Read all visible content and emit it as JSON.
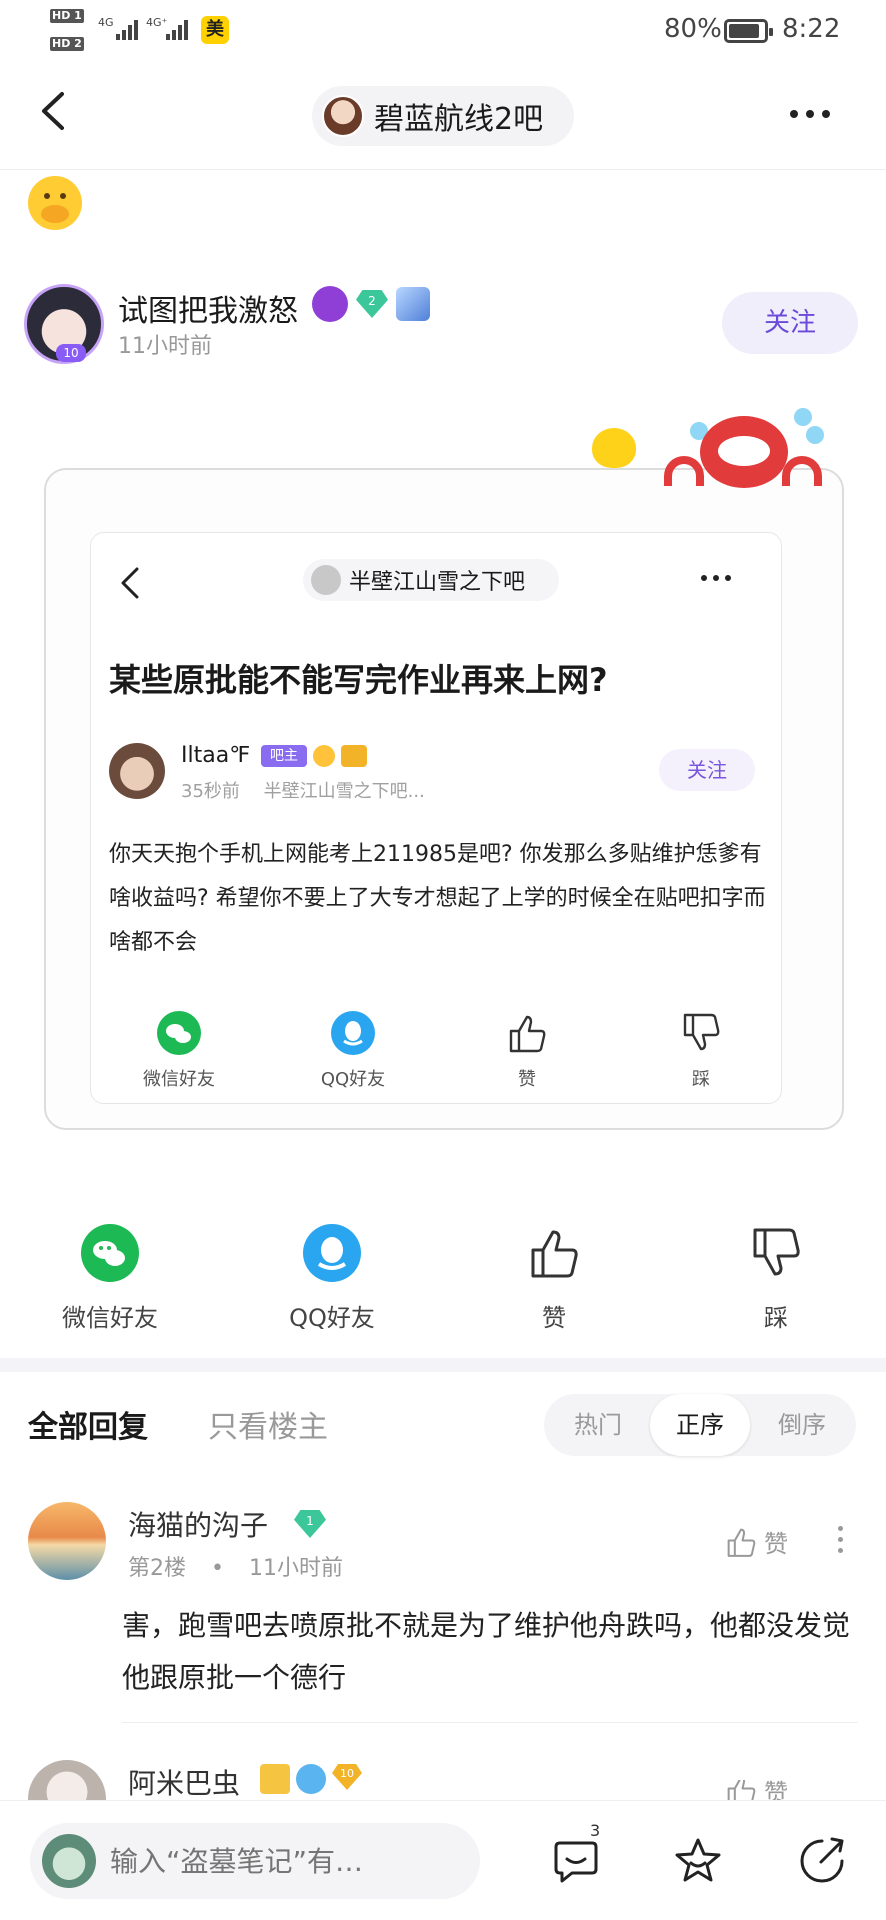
{
  "status_bar": {
    "hd1": "HD 1",
    "hd2": "HD 2",
    "sig1": "4G",
    "sig2": "4G⁺",
    "mei": "美",
    "battery": "80%",
    "time": "8:22"
  },
  "header": {
    "forum_name": "碧蓝航线2吧"
  },
  "author": {
    "name": "试图把我激怒",
    "level": "2",
    "time": "11小时前",
    "follow_label": "关注",
    "avatar_badge": "10"
  },
  "screenshot": {
    "forum_name": "半壁江山雪之下吧",
    "title": "某些原批能不能写完作业再来上网?",
    "user_name": "Iltaa℉",
    "owner_badge": "吧主",
    "meta_time": "35秒前",
    "meta_forum": "半壁江山雪之下吧...",
    "follow_label": "关注",
    "body": "你天天抱个手机上网能考上211985是吧? 你发那么多贴维护恁爹有啥收益吗? 希望你不要上了大专才想起了上学的时候全在贴吧扣字而啥都不会",
    "actions": [
      "微信好友",
      "QQ好友",
      "赞",
      "踩"
    ]
  },
  "share": {
    "wechat": "微信好友",
    "qq": "QQ好友",
    "like": "赞",
    "dislike": "踩"
  },
  "replies": {
    "tab_all": "全部回复",
    "tab_owner": "只看楼主",
    "sort_hot": "热门",
    "sort_asc": "正序",
    "sort_desc": "倒序"
  },
  "comments": [
    {
      "name": "海猫的沟子",
      "level": "1",
      "floor": "第2楼",
      "time": "11小时前",
      "like": "赞",
      "text": "害，跑雪吧去喷原批不就是为了维护他舟跌吗，他都没发觉他跟原批一个德行"
    },
    {
      "name": "阿米巴虫",
      "level": "10",
      "like": "赞"
    }
  ],
  "bottom": {
    "input_placeholder": "输入“盗墓笔记”有…",
    "comment_count": "3"
  },
  "colors": {
    "accent_purple": "#6c4ad8",
    "wechat_green": "#1db954",
    "qq_blue": "#2aa6f0"
  }
}
